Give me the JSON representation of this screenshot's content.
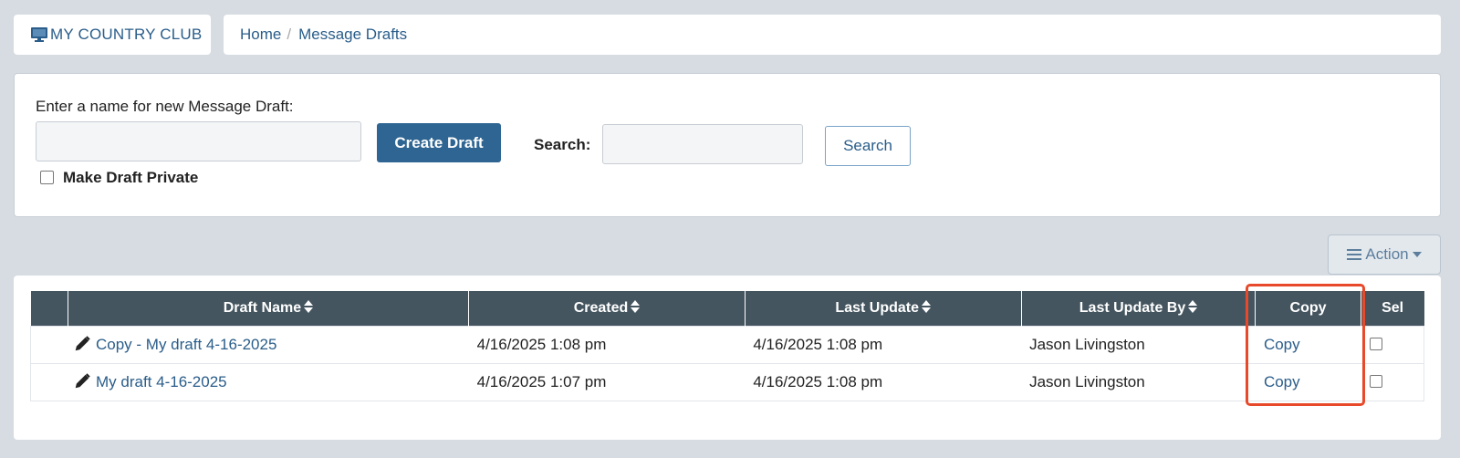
{
  "header": {
    "brand": "MY COUNTRY CLUB",
    "breadcrumb": [
      "Home",
      "Message Drafts"
    ]
  },
  "form": {
    "draft_label": "Enter a name for new Message Draft:",
    "draft_value": "",
    "create_button": "Create Draft",
    "private_label": "Make Draft Private",
    "private_checked": false,
    "search_label": "Search:",
    "search_value": "",
    "search_button": "Search"
  },
  "toolbar": {
    "action_button": "Action"
  },
  "table": {
    "columns": [
      "",
      "Draft Name",
      "Created",
      "Last Update",
      "Last Update By",
      "Copy",
      "Sel"
    ],
    "rows": [
      {
        "name": "Copy - My draft 4-16-2025",
        "created": "4/16/2025 1:08 pm",
        "updated": "4/16/2025 1:08 pm",
        "updated_by": "Jason Livingston",
        "copy": "Copy",
        "selected": false
      },
      {
        "name": "My draft 4-16-2025",
        "created": "4/16/2025 1:07 pm",
        "updated": "4/16/2025 1:08 pm",
        "updated_by": "Jason Livingston",
        "copy": "Copy",
        "selected": false
      }
    ]
  },
  "colors": {
    "page_bg": "#d6dce2",
    "link": "#2a5d8a",
    "primary_button": "#2f6592",
    "table_header": "#44555f",
    "highlight": "#e8492a"
  },
  "icons": [
    "monitor-icon",
    "pencil-icon",
    "sort-icon",
    "hamburger-icon",
    "caret-down-icon"
  ]
}
